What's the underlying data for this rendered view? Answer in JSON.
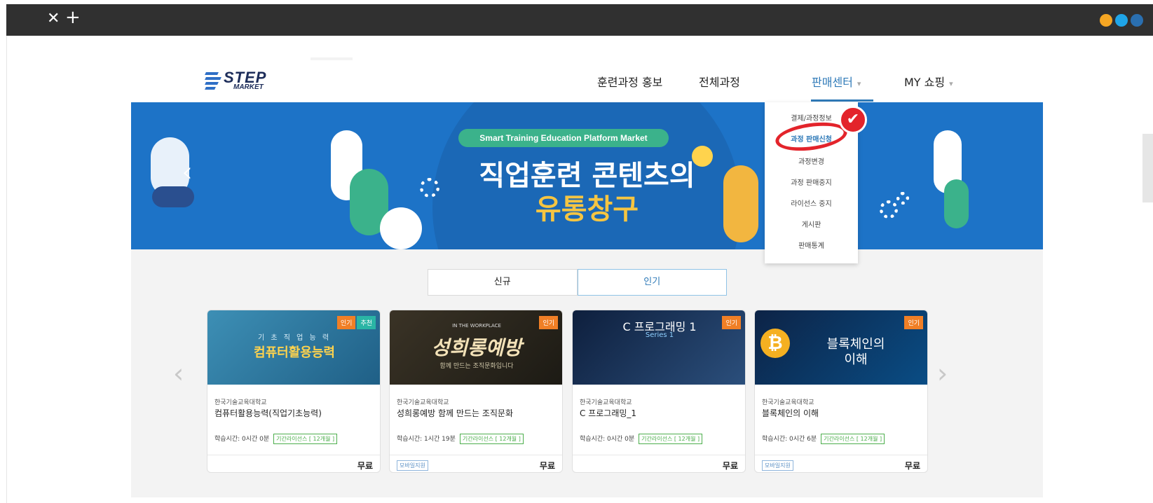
{
  "browser": {
    "close_glyph": "✕",
    "newtab_glyph": "+",
    "dots": [
      "#f5a623",
      "#1fa5e8",
      "#2a6fb0"
    ]
  },
  "header": {
    "logo": {
      "line1": "STEP",
      "line2": "MARKET"
    },
    "nav": [
      {
        "label": "훈련과정 홍보"
      },
      {
        "label": "전체과정"
      },
      {
        "label": "판매센터",
        "caret": "▾"
      },
      {
        "label": "MY 쇼핑",
        "caret": "▾"
      }
    ]
  },
  "banner": {
    "pill": "Smart Training Education Platform Market",
    "headline1": "직업훈련 콘텐츠의",
    "headline2": "유통창구",
    "prev_glyph": "‹",
    "next_glyph": "›"
  },
  "dropdown": {
    "items": [
      "결제/과정정보",
      "과정 판매신청",
      "과정변경",
      "과정 판매중지",
      "라이선스 중지",
      "게시판",
      "판매통계"
    ],
    "selected_index": 1,
    "annotation_glyph": "✔"
  },
  "tabs": [
    "신규",
    "인기"
  ],
  "carousel": {
    "prev_glyph": "‹",
    "next_glyph": "›"
  },
  "cards": [
    {
      "thumb_line1": "기 초 직 업 능 력",
      "thumb_line2": "컴퓨터활용능력",
      "badges": [
        "인기",
        "추천"
      ],
      "university": "한국기술교육대학교",
      "title": "컴퓨터활용능력(직업기초능력)",
      "study_time": "학습시간: 0시간 0분",
      "license": "기간라이선스 [ 12개월 ]",
      "mobile": "",
      "price": "무료"
    },
    {
      "thumb_line1": "IN THE WORKPLACE",
      "thumb_line2": "성희롱예방",
      "thumb_line3": "함께 만드는 조직문화입니다",
      "badges": [
        "인기"
      ],
      "university": "한국기술교육대학교",
      "title": "성희롱예방 함께 만드는 조직문화",
      "study_time": "학습시간: 1시간 19분",
      "license": "기간라이선스 [ 12개월 ]",
      "mobile": "모바일지원",
      "price": "무료"
    },
    {
      "thumb_line1": "C 프로그래밍 1",
      "thumb_line2": "Series 1",
      "badges": [
        "인기"
      ],
      "university": "한국기술교육대학교",
      "title": "C 프로그래밍_1",
      "study_time": "학습시간: 0시간 0분",
      "license": "기간라이선스 [ 12개월 ]",
      "mobile": "",
      "price": "무료"
    },
    {
      "thumb_line1": "블록체인의",
      "thumb_line2": "이해",
      "coin": "₿",
      "badges": [
        "인기"
      ],
      "university": "한국기술교육대학교",
      "title": "블록체인의 이해",
      "study_time": "학습시간: 0시간 6분",
      "license": "기간라이선스 [ 12개월 ]",
      "mobile": "모바일지원",
      "price": "무료"
    }
  ]
}
